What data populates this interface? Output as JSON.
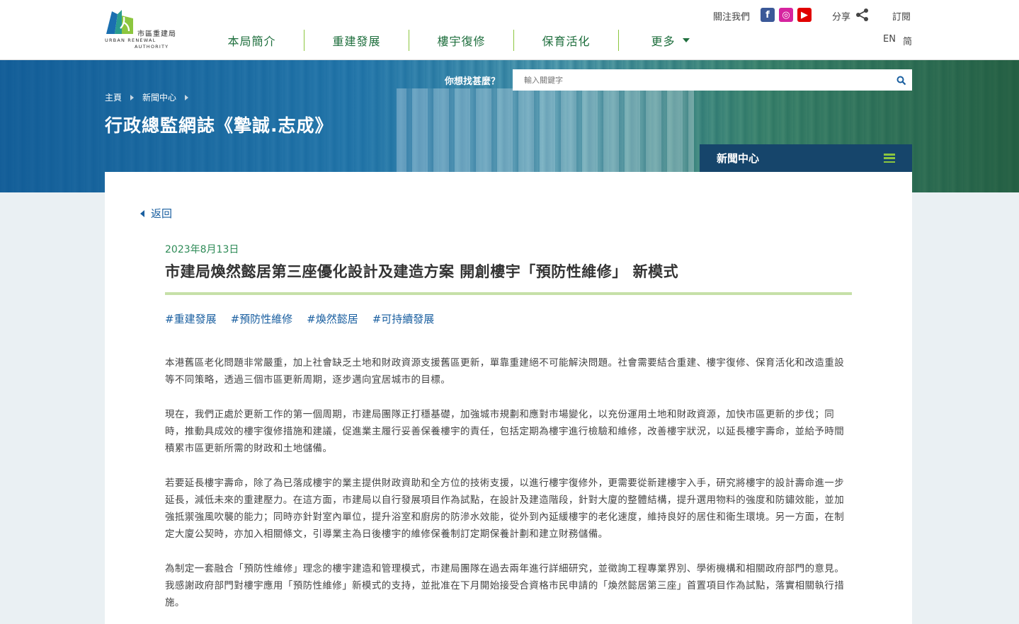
{
  "header": {
    "logo": {
      "zh": "市區重建局",
      "en_line1": "URBAN RENEWAL",
      "en_line2": "AUTHORITY",
      "colors": {
        "blue": "#1a6fb0",
        "green": "#8cc63f",
        "teal": "#2a9d8f"
      }
    },
    "nav": [
      {
        "label": "本局簡介"
      },
      {
        "label": "重建發展"
      },
      {
        "label": "樓宇復修"
      },
      {
        "label": "保育活化"
      },
      {
        "label": "更多"
      }
    ],
    "follow_label": "關注我們",
    "social": [
      {
        "icon": "facebook-icon",
        "glyph": "f"
      },
      {
        "icon": "instagram-icon",
        "glyph": "◎"
      },
      {
        "icon": "youtube-icon",
        "glyph": "▶"
      }
    ],
    "share_label": "分享",
    "subscribe_label": "訂閱",
    "lang_en": "EN",
    "lang_sc": "简"
  },
  "banner": {
    "search_label": "你想找甚麼？",
    "search_placeholder": "輸入關鍵字",
    "breadcrumb": [
      "主頁",
      "新聞中心"
    ],
    "page_title": "行政總監網誌《摯誠.志成》",
    "section_menu_label": "新聞中心"
  },
  "article": {
    "back_label": "返回",
    "date": "2023年8月13日",
    "title": "市建局煥然懿居第三座優化設計及建造方案 開創樓宇「預防性維修」 新模式",
    "tags": [
      "#重建發展",
      "#預防性維修",
      "#煥然懿居",
      "#可持續發展"
    ],
    "paragraphs": [
      "本港舊區老化問題非常嚴重，加上社會缺乏土地和財政資源支援舊區更新，單靠重建絕不可能解決問題。社會需要結合重建、樓宇復修、保育活化和改造重設等不同策略，透過三個市區更新周期，逐步邁向宜居城市的目標。",
      "現在，我們正處於更新工作的第一個周期，市建局團隊正打穩基礎，加強城市規劃和應對市場變化，以充份運用土地和財政資源，加快市區更新的步伐；同時，推動具成效的樓宇復修措施和建議，促進業主履行妥善保養樓宇的責任，包括定期為樓宇進行檢驗和維修，改善樓宇狀況，以延長樓宇壽命，並給予時間積累市區更新所需的財政和土地儲備。",
      "若要延長樓宇壽命，除了為已落成樓宇的業主提供財政資助和全方位的技術支援，以進行樓宇復修外，更需要從新建樓宇入手，研究將樓宇的設計壽命進一步延長，減低未來的重建壓力。在這方面，市建局以自行發展項目作為試點，在設計及建造階段，針對大廈的整體結構，提升選用物料的強度和防鏽效能，並加強抵禦強風吹襲的能力；同時亦針對室內單位，提升浴室和廚房的防滲水效能，從外到內延緩樓宇的老化速度，維持良好的居住和衛生環境。另一方面，在制定大廈公契時，亦加入相關條文，引導業主為日後樓宇的維修保養制訂定期保養計劃和建立財務儲備。",
      "為制定一套融合「預防性維修」理念的樓宇建造和管理模式，市建局團隊在過去兩年進行詳細研究，並徵詢工程專業界別、學術機構和相關政府部門的意見。我感謝政府部門對樓宇應用「預防性維修」新模式的支持，並批准在下月開始接受合資格市民申請的「煥然懿居第三座」首置項目作為試點，落實相關執行措施。"
    ]
  }
}
